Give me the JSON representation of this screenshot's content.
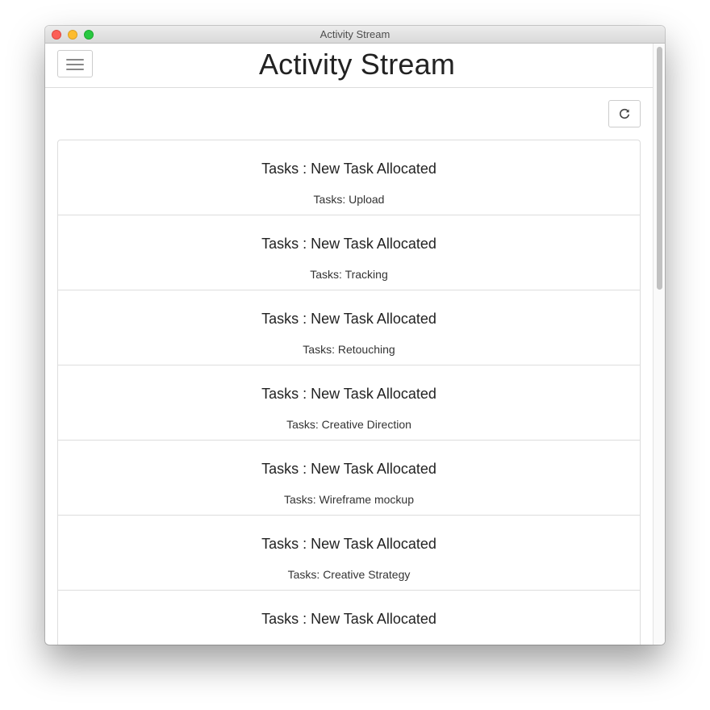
{
  "window": {
    "title": "Activity Stream"
  },
  "header": {
    "title": "Activity Stream",
    "menu_icon": "hamburger-icon"
  },
  "toolbar": {
    "refresh_icon": "refresh-icon"
  },
  "activities": [
    {
      "heading": "Tasks : New Task Allocated",
      "text": "Tasks: Upload"
    },
    {
      "heading": "Tasks : New Task Allocated",
      "text": "Tasks: Tracking"
    },
    {
      "heading": "Tasks : New Task Allocated",
      "text": "Tasks: Retouching"
    },
    {
      "heading": "Tasks : New Task Allocated",
      "text": "Tasks: Creative Direction"
    },
    {
      "heading": "Tasks : New Task Allocated",
      "text": "Tasks: Wireframe mockup"
    },
    {
      "heading": "Tasks : New Task Allocated",
      "text": "Tasks: Creative Strategy"
    },
    {
      "heading": "Tasks : New Task Allocated"
    }
  ],
  "colors": {
    "close": "#fc5f57",
    "minimize": "#fdbc2e",
    "zoom": "#28c840",
    "border": "#dddddd",
    "text": "#222222"
  }
}
